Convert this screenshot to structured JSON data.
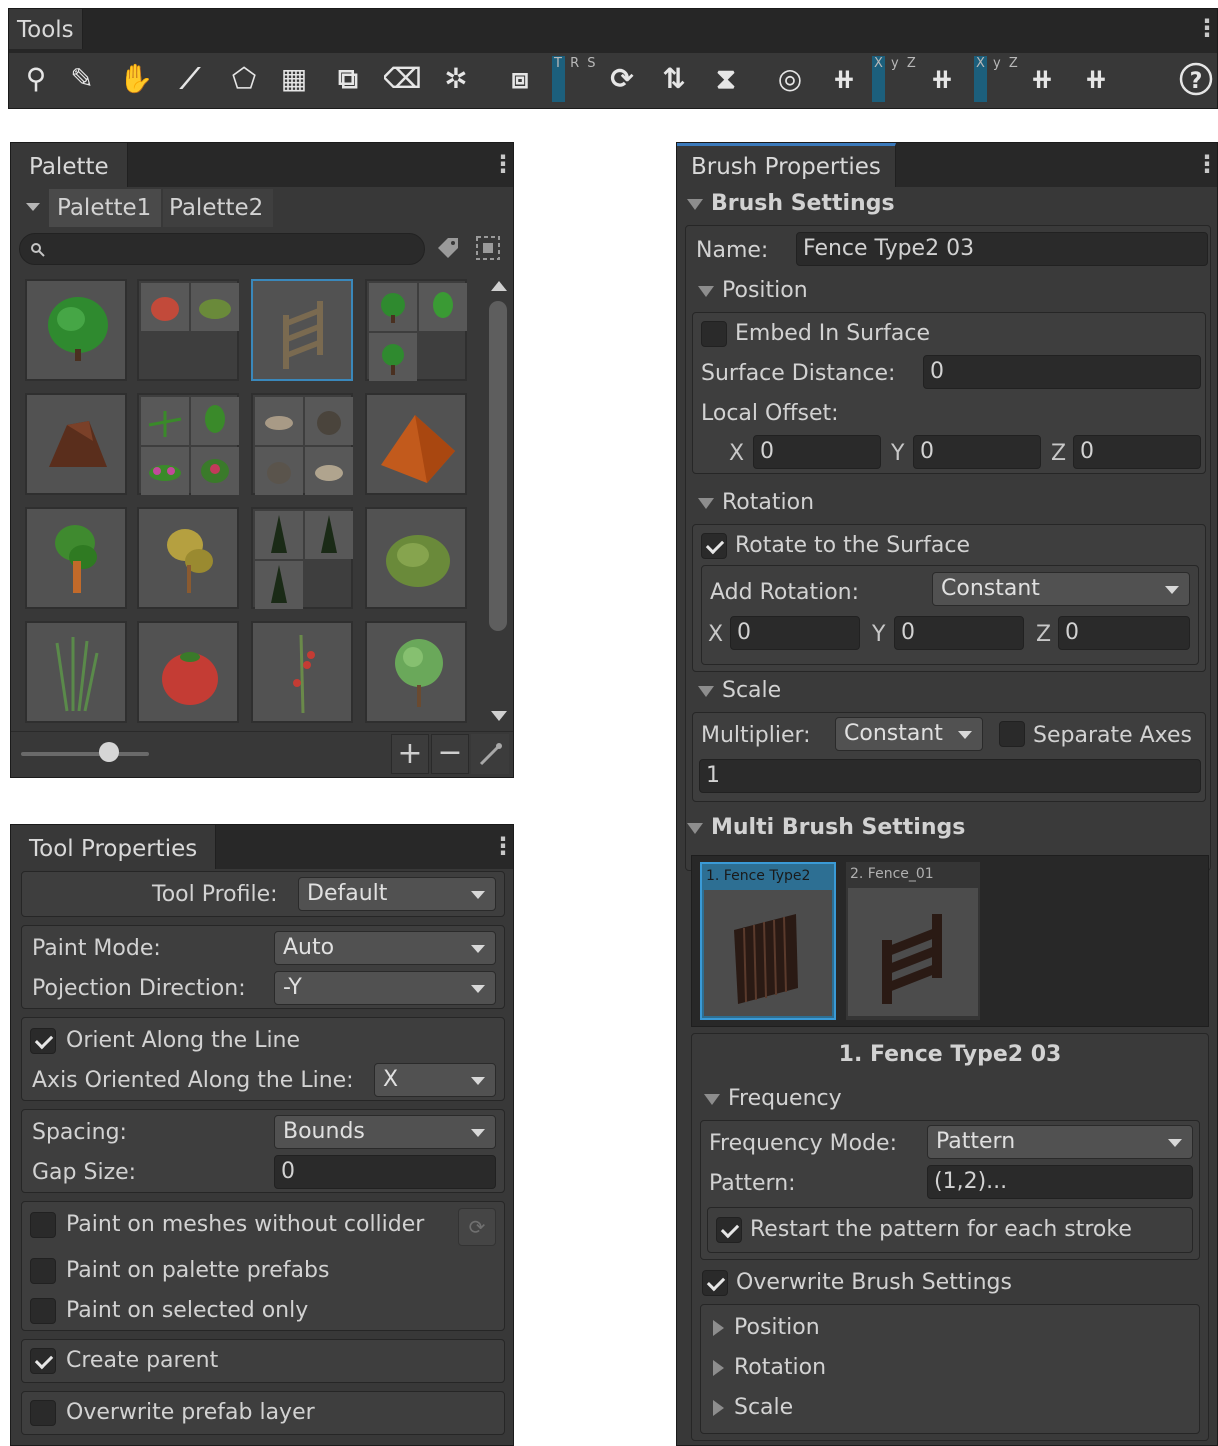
{
  "tools": {
    "title": "Tools",
    "icons": [
      "pin-tool-icon",
      "paint-brush-tool-icon",
      "pin-stamp-tool-icon",
      "line-tool-icon",
      "shape-tool-icon",
      "tiling-tool-icon",
      "replacer-tool-icon",
      "eraser-tool-icon",
      "gravity-tool-icon",
      "selection-tool-icon",
      "rotate-icon",
      "mirror-icon",
      "extrude-icon",
      "radial-grid-icon",
      "snap-grid-icon",
      "grid-xyz-icon",
      "grid-origin-icon",
      "grid-settings-icon",
      "help-icon"
    ],
    "trs_label": "T R S",
    "xyz_label_1": "X y Z",
    "xyz_label_2": "X y Z"
  },
  "palette": {
    "title": "Palette",
    "tabs": [
      {
        "label": "Palette1"
      },
      {
        "label": "Palette2"
      }
    ],
    "search_placeholder": "",
    "items": [
      {
        "name": "green-tree"
      },
      {
        "name": "bushes-pair"
      },
      {
        "name": "wooden-fence"
      },
      {
        "name": "green-shrubs"
      },
      {
        "name": "tree-stump"
      },
      {
        "name": "plants-and-flowers"
      },
      {
        "name": "rocks"
      },
      {
        "name": "orange-tent"
      },
      {
        "name": "orange-trunk-tree"
      },
      {
        "name": "yellow-tree"
      },
      {
        "name": "pine-trees"
      },
      {
        "name": "cabbage"
      },
      {
        "name": "tall-grass"
      },
      {
        "name": "tomato"
      },
      {
        "name": "tomato-plant"
      },
      {
        "name": "round-tree"
      }
    ]
  },
  "tool_properties": {
    "title": "Tool Properties",
    "tool_profile_label": "Tool Profile:",
    "tool_profile_value": "Default",
    "paint_mode_label": "Paint Mode:",
    "paint_mode_value": "Auto",
    "projection_label": "Pojection Direction:",
    "projection_value": "-Y",
    "orient_label": "Orient Along the Line",
    "orient_checked": true,
    "axis_label": "Axis Oriented Along the Line:",
    "axis_value": "X",
    "spacing_label": "Spacing:",
    "spacing_value": "Bounds",
    "gap_label": "Gap Size:",
    "gap_value": "0",
    "paint_no_collider_label": "Paint on meshes without collider",
    "paint_palette_label": "Paint on palette prefabs",
    "paint_selected_label": "Paint on selected only",
    "create_parent_label": "Create parent",
    "overwrite_layer_label": "Overwrite prefab layer"
  },
  "brush_properties": {
    "title": "Brush Properties",
    "brush_settings_label": "Brush Settings",
    "name_label": "Name:",
    "name_value": "Fence Type2 03",
    "position_label": "Position",
    "embed_label": "Embed In Surface",
    "surface_distance_label": "Surface Distance:",
    "surface_distance_value": "0",
    "local_offset_label": "Local Offset:",
    "offset_x": "0",
    "offset_y": "0",
    "offset_z": "0",
    "rotation_label": "Rotation",
    "rotate_surface_label": "Rotate to the Surface",
    "add_rotation_label": "Add Rotation:",
    "add_rotation_value": "Constant",
    "rot_x": "0",
    "rot_y": "0",
    "rot_z": "0",
    "scale_label": "Scale",
    "multiplier_label": "Multiplier:",
    "multiplier_value": "Constant",
    "separate_axes_label": "Separate Axes",
    "scale_value": "1",
    "multi_brush_label": "Multi Brush Settings",
    "brush_items": [
      {
        "label": "1. Fence Type2"
      },
      {
        "label": "2. Fence_01"
      }
    ],
    "selected_item_title": "1. Fence Type2 03",
    "frequency_label": "Frequency",
    "frequency_mode_label": "Frequency Mode:",
    "frequency_mode_value": "Pattern",
    "pattern_label": "Pattern:",
    "pattern_value": "(1,2)...",
    "restart_label": "Restart the pattern for each stroke",
    "overwrite_label": "Overwrite Brush Settings",
    "sub_position_label": "Position",
    "sub_rotation_label": "Rotation",
    "sub_scale_label": "Scale"
  },
  "axes": {
    "x": "X",
    "y": "Y",
    "z": "Z"
  },
  "colors": {
    "panel": "#383838",
    "accent": "#3a79bb",
    "field": "#2a2a2a"
  }
}
